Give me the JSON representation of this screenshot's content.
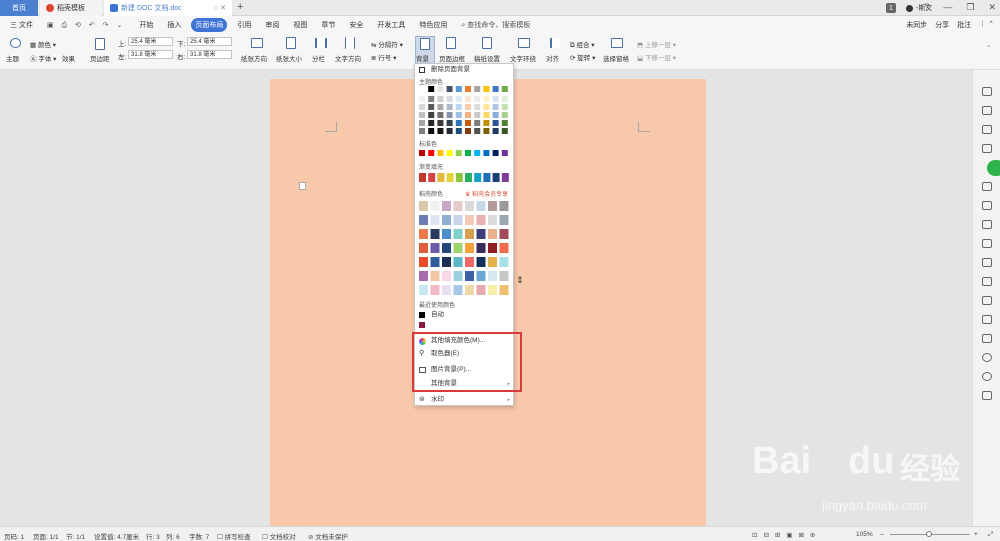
{
  "titlebar": {
    "home_tab": "首页",
    "store_tab": "稻壳模板",
    "doc_tab": "新建 DOC 文档.doc",
    "new_tab": "+",
    "page_count_badge": "1",
    "user": "-斯文"
  },
  "menubar": {
    "file": "三 文件",
    "items": [
      "开始",
      "插入",
      "页面布局",
      "引用",
      "审阅",
      "视图",
      "章节",
      "安全",
      "开发工具",
      "特色应用"
    ],
    "active": "页面布局",
    "search": "查找命令、搜索模板",
    "right": [
      "未同步",
      "分享",
      "批注"
    ]
  },
  "ribbon": {
    "theme": "主题",
    "color": "颜色",
    "font": "字体",
    "effect": "效果",
    "margin": "页边距",
    "top_label": "上:",
    "top_value": "25.4 毫米",
    "bottom_label": "下:",
    "bottom_value": "25.4 毫米",
    "left_label": "左:",
    "left_value": "31.8 毫米",
    "right_label": "右:",
    "right_value": "31.8 毫米",
    "orientation": "纸张方向",
    "size": "纸张大小",
    "columns": "分栏",
    "text_dir": "文字方向",
    "line_no": "行号",
    "break": "分隔符",
    "background": "背景",
    "border": "页面边框",
    "draft": "稿纸设置",
    "wrap": "文字环绕",
    "align": "对齐",
    "rotate": "旋转",
    "group": "组合",
    "select_pane": "选择窗格",
    "up_layer": "上移一层",
    "down_layer": "下移一层"
  },
  "dropdown": {
    "remove_bg": "删除页面背景",
    "theme_colors": "主题颜色",
    "standard_colors": "标准色",
    "gradient_fill": "渐变填充",
    "daoke_colors": "稻壳颜色",
    "member_only": "稻壳会员专享",
    "recent_colors": "最近使用颜色",
    "auto": "自动",
    "more_colors": "其他填充颜色(M)...",
    "eyedropper": "取色器(E)",
    "picture_bg": "图片背景(P)...",
    "other_bg": "其他背景",
    "watermark": "水印"
  },
  "statusbar": {
    "page": "页码: 1",
    "pages": "页面: 1/1",
    "section": "节: 1/1",
    "setting": "设置值: 4.7厘米",
    "row": "行: 3",
    "col": "列: 6",
    "words": "字数: 7",
    "spell": "拼写检查",
    "proof": "文档校对",
    "protect": "文档未保护",
    "zoom": "105%"
  },
  "watermark": {
    "brand": "Bai",
    "brand2": "du",
    "cn": "经验",
    "url": "jingyan.baidu.com"
  },
  "colors": {
    "page_bg": "#f8c8ab",
    "accent": "#3f73d6",
    "highlight": "#d93a3a"
  }
}
